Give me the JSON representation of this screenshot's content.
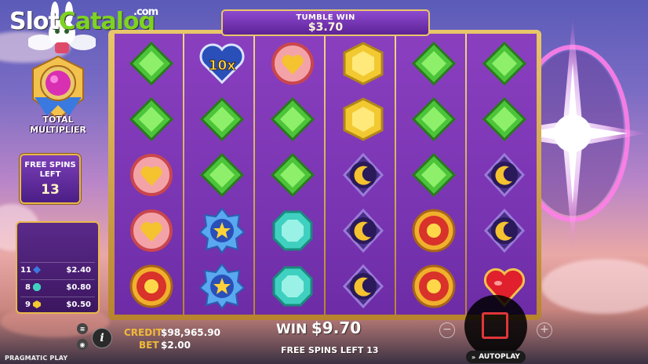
{
  "branding": {
    "logo_slot": "Slot",
    "logo_catalog": "Catalog",
    "logo_com": ".com",
    "provider": "PRAGMATIC PLAY"
  },
  "multiplier": {
    "label": "TOTAL\nMULTIPLIER"
  },
  "free_spins": {
    "label": "FREE SPINS\nLEFT",
    "count": "13"
  },
  "paytable": [
    {
      "count": "11",
      "icon": "blue-gem-icon",
      "value": "$2.40"
    },
    {
      "count": "8",
      "icon": "teal-gem-icon",
      "value": "$0.80"
    },
    {
      "count": "9",
      "icon": "yellow-gem-icon",
      "value": "$0.50"
    }
  ],
  "tumble": {
    "label": "TUMBLE WIN",
    "value": "$3.70"
  },
  "multiplier_bomb": {
    "value": "10x"
  },
  "grid": {
    "columns": [
      [
        "green-gem",
        "green-gem",
        "heart-badge",
        "heart-badge",
        "sun-badge"
      ],
      [
        "multiplier-10x",
        "green-gem",
        "green-gem",
        "star-badge",
        "star-badge"
      ],
      [
        "heart-badge",
        "green-gem",
        "green-gem",
        "teal-gem",
        "teal-gem"
      ],
      [
        "yellow-gem",
        "yellow-gem",
        "moon-badge",
        "moon-badge",
        "moon-badge"
      ],
      [
        "green-gem",
        "green-gem",
        "green-gem",
        "sun-badge",
        "sun-badge"
      ],
      [
        "green-gem",
        "green-gem",
        "moon-badge",
        "moon-badge",
        "red-heart-gem"
      ]
    ]
  },
  "footer": {
    "credit_label": "CREDIT",
    "credit_value": "$98,965.90",
    "bet_label": "BET",
    "bet_value": "$2.00",
    "win_label": "WIN",
    "win_value": "$9.70",
    "free_spins_left": "FREE SPINS LEFT 13",
    "autoplay_label": "AUTOPLAY",
    "info_label": "i",
    "minus": "−",
    "plus": "+"
  },
  "colors": {
    "accent": "#e9c76a",
    "grid_bg": "#7a35b3",
    "spin_stop": "#e0363a"
  }
}
